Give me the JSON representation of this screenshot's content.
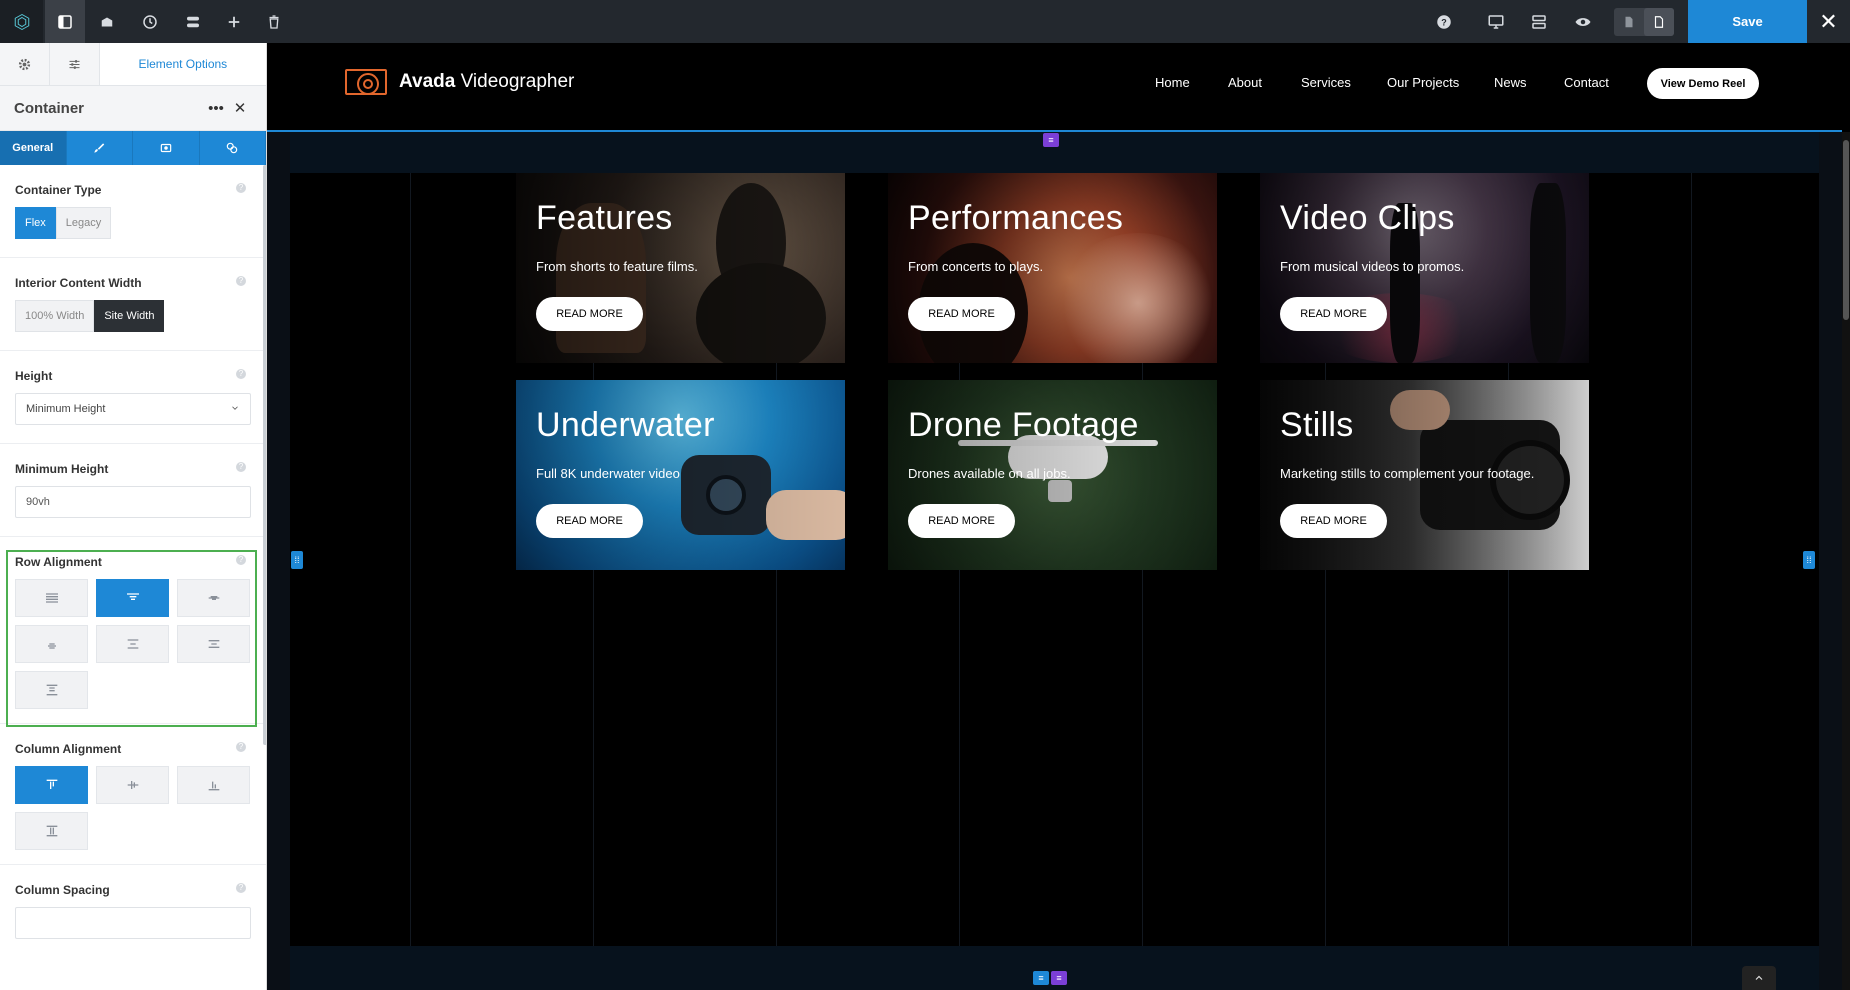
{
  "toolbar": {
    "save_label": "Save",
    "close_label": "✕"
  },
  "sidebar": {
    "tab_label": "Element Options",
    "panel_title": "Container",
    "subtabs": [
      "General"
    ],
    "container_type": {
      "title": "Container Type",
      "options": [
        "Flex",
        "Legacy"
      ],
      "selected": "Flex"
    },
    "interior_width": {
      "title": "Interior Content Width",
      "options": [
        "100% Width",
        "Site Width"
      ],
      "selected": "Site Width"
    },
    "height": {
      "title": "Height",
      "value": "Minimum Height"
    },
    "min_height": {
      "title": "Minimum Height",
      "value": "90vh"
    },
    "row_alignment": {
      "title": "Row Alignment"
    },
    "column_alignment": {
      "title": "Column Alignment"
    },
    "column_spacing": {
      "title": "Column Spacing",
      "value": ""
    }
  },
  "site": {
    "logo_bold": "Avada",
    "logo_rest": " Videographer",
    "nav": [
      "Home",
      "About",
      "Services",
      "Our Projects",
      "News",
      "Contact"
    ],
    "cta": "View Demo Reel"
  },
  "cards": [
    {
      "title": "Features",
      "subtitle": "From shorts to feature films.",
      "button": "READ MORE"
    },
    {
      "title": "Performances",
      "subtitle": "From concerts to plays.",
      "button": "READ MORE"
    },
    {
      "title": "Video Clips",
      "subtitle": "From musical videos to promos.",
      "button": "READ MORE"
    },
    {
      "title": "Underwater",
      "subtitle": "Full 8K underwater video",
      "button": "READ MORE"
    },
    {
      "title": "Drone Footage",
      "subtitle": "Drones available on all jobs.",
      "button": "READ MORE"
    },
    {
      "title": "Stills",
      "subtitle": "Marketing stills to complement your footage.",
      "button": "READ MORE"
    }
  ]
}
